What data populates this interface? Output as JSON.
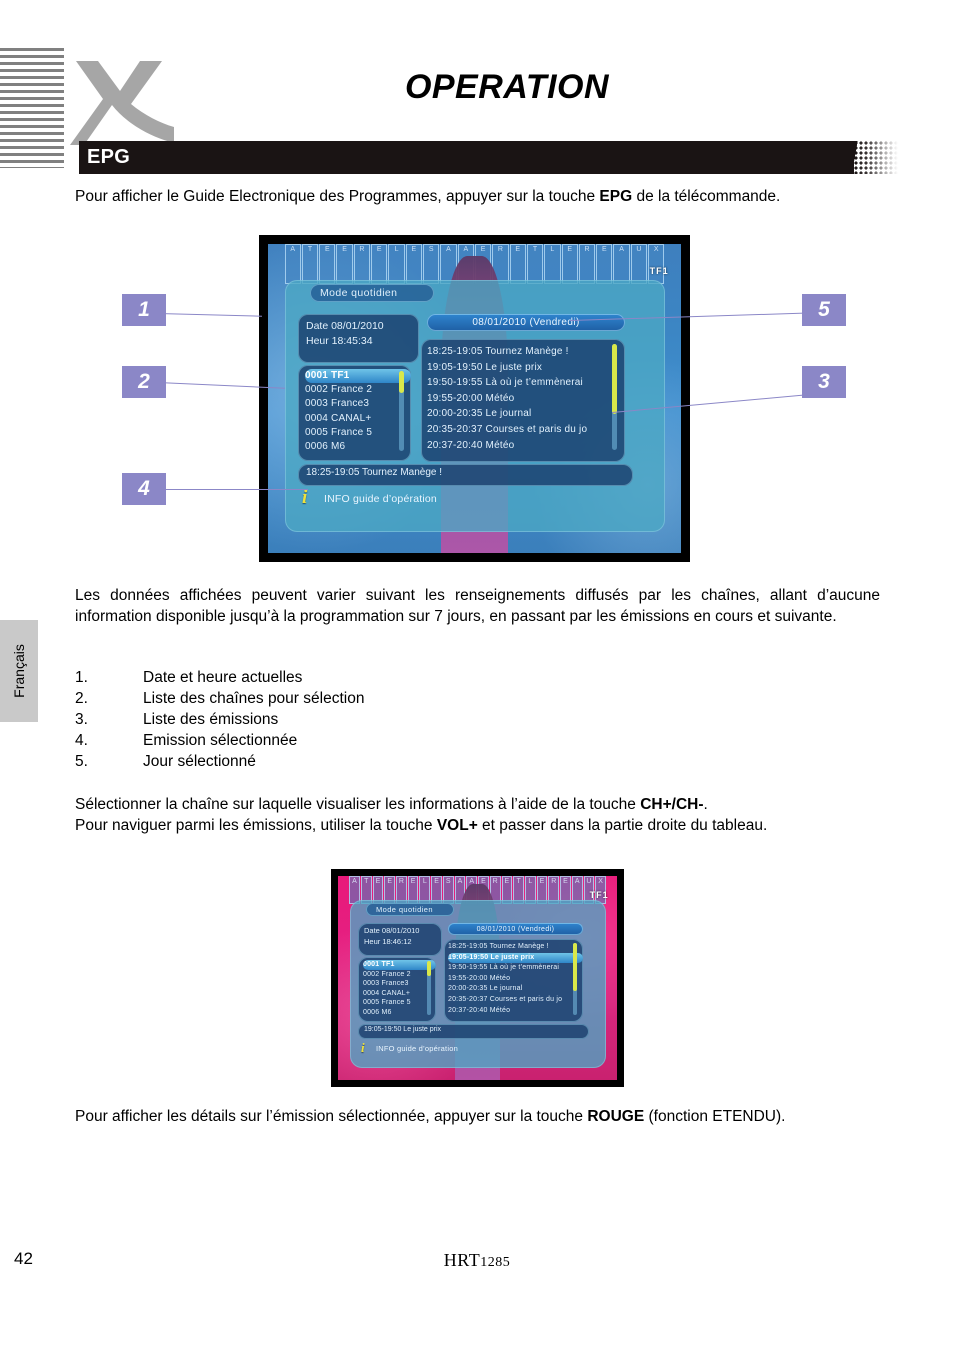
{
  "header": {
    "title": "OPERATION",
    "logo_alt": "xoro-x-logo",
    "section_label": "EPG"
  },
  "language_tab": {
    "label": "Français"
  },
  "paragraphs": {
    "intro_pre": "Pour afficher le Guide Electronique des Programmes, appuyer sur la touche ",
    "intro_bold": "EPG",
    "intro_post": " de la télécommande.",
    "data_note": "Les données affichées peuvent varier suivant les renseignements diffusés par les chaînes, allant d’aucune information disponible jusqu’à la programmation sur 7 jours, en passant par les émissions en cours et suivante.",
    "select_pre": "Sélectionner la chaîne sur laquelle visualiser les informations à l’aide de la touche ",
    "select_bold": "CH+/CH-",
    "select_post": ".",
    "nav_pre": "Pour naviguer parmi les émissions, utiliser la touche ",
    "nav_bold": "VOL+",
    "nav_post": " et passer dans la partie droite du tableau.",
    "detail_pre": "Pour afficher les détails sur l’émission sélectionnée, appuyer sur la touche ",
    "detail_bold": "ROUGE",
    "detail_post": " (fonction ETENDU)."
  },
  "legend": [
    {
      "num": "1.",
      "text": "Date et heure actuelles"
    },
    {
      "num": "2.",
      "text": "Liste des chaînes pour sélection"
    },
    {
      "num": "3.",
      "text": "Liste des émissions"
    },
    {
      "num": "4.",
      "text": "Emission sélectionnée"
    },
    {
      "num": "5.",
      "text": "Jour sélectionné"
    }
  ],
  "callouts": [
    {
      "id": "1",
      "label": "1"
    },
    {
      "id": "2",
      "label": "2"
    },
    {
      "id": "3",
      "label": "3"
    },
    {
      "id": "4",
      "label": "4"
    },
    {
      "id": "5",
      "label": "5"
    }
  ],
  "screenshot_top": {
    "mode_label": "Mode quotidien",
    "date_line": "Date 08/01/2010",
    "time_line": "Heur   18:45:34",
    "day_bar": "08/01/2010 (Vendredi)",
    "channel_brand": "TF1",
    "channels": [
      "0001 TF1",
      "0002 France 2",
      "0003 France3",
      "0004 CANAL+",
      "0005 France 5",
      "0006 M6"
    ],
    "selected_channel_index": 0,
    "programs": [
      "18:25-19:05  Tournez Manège !",
      "19:05-19:50  Le juste prix",
      "19:50-19:55  Là où je t’emmènerai",
      "19:55-20:00  Météo",
      "20:00-20:35  Le journal",
      "20:35-20:37  Courses et paris du jo",
      "20:37-20:40  Météo"
    ],
    "selected_program_index": -1,
    "selected_bar": "18:25-19:05  Tournez Manège !",
    "info_icon": "i",
    "info_text": "INFO guide d’opération",
    "grid_cells": [
      "A",
      "T",
      "E",
      "E",
      "R",
      "E",
      "L",
      "E",
      "S",
      "A",
      "A",
      "E",
      "R",
      "E",
      "T",
      "L",
      "E",
      "R",
      "E",
      "A",
      "U",
      "X"
    ]
  },
  "screenshot_bottom": {
    "mode_label": "Mode quotidien",
    "date_line": "Date 08/01/2010",
    "time_line": "Heur   18:46:12",
    "day_bar": "08/01/2010 (Vendredi)",
    "channel_brand": "TF1",
    "channels": [
      "0001 TF1",
      "0002 France 2",
      "0003 France3",
      "0004 CANAL+",
      "0005 France 5",
      "0006 M6"
    ],
    "selected_channel_index": 0,
    "programs": [
      "18:25-19:05  Tournez Manège !",
      "19:05-19:50  Le juste prix",
      "19:50-19:55  Là où je t’emmènerai",
      "19:55-20:00  Météo",
      "20:00-20:35  Le journal",
      "20:35-20:37  Courses et paris du jo",
      "20:37-20:40  Météo"
    ],
    "selected_program_index": 1,
    "selected_bar": "19:05-19:50  Le juste prix",
    "info_icon": "i",
    "info_text": "INFO guide d’opération",
    "grid_cells": [
      "A",
      "T",
      "E",
      "E",
      "R",
      "E",
      "L",
      "E",
      "S",
      "A",
      "A",
      "E",
      "R",
      "E",
      "T",
      "L",
      "E",
      "R",
      "E",
      "A",
      "U",
      "X"
    ]
  },
  "footer": {
    "page_number": "42",
    "model_main": "HRT",
    "model_sub": "1285"
  },
  "colors": {
    "callout": "#8b87c7",
    "section_bar": "#1a1414",
    "lang_tab": "#c9c9c9",
    "logo_gray": "#a6a6a6"
  }
}
